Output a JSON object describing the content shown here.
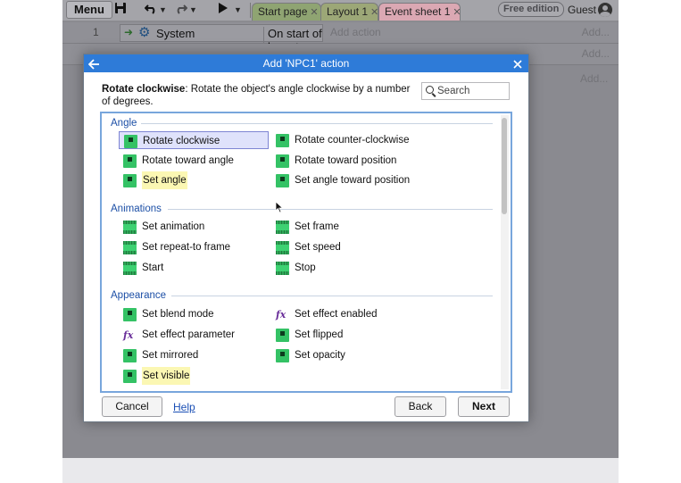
{
  "toolbar": {
    "menu_label": "Menu",
    "tabs": [
      {
        "label": "Start page",
        "close": "✕"
      },
      {
        "label": "Layout 1",
        "close": "✕"
      },
      {
        "label": "Event sheet 1",
        "close": "✕"
      }
    ],
    "edition_badge": "Free edition",
    "user_label": "Guest"
  },
  "event_sheet": {
    "row_number": "1",
    "object": "System",
    "trigger": "On start of layout",
    "add_action": "Add action",
    "add_label": "Add..."
  },
  "dialog": {
    "title": "Add 'NPC1' action",
    "description_bold": "Rotate clockwise",
    "description_rest": ": Rotate the object's angle clockwise by a number of degrees.",
    "search_placeholder": "Search",
    "categories": [
      {
        "name": "Angle",
        "items": [
          {
            "label": "Rotate clockwise",
            "icon": "sprite-icon",
            "selected": true
          },
          {
            "label": "Rotate counter-clockwise",
            "icon": "sprite-icon"
          },
          {
            "label": "Rotate toward angle",
            "icon": "sprite-icon"
          },
          {
            "label": "Rotate toward position",
            "icon": "sprite-icon"
          },
          {
            "label": "Set angle",
            "icon": "sprite-icon",
            "highlighted": true
          },
          {
            "label": "Set angle toward position",
            "icon": "sprite-icon"
          }
        ]
      },
      {
        "name": "Animations",
        "items": [
          {
            "label": "Set animation",
            "icon": "animation-icon"
          },
          {
            "label": "Set frame",
            "icon": "animation-icon"
          },
          {
            "label": "Set repeat-to frame",
            "icon": "animation-icon"
          },
          {
            "label": "Set speed",
            "icon": "animation-icon"
          },
          {
            "label": "Start",
            "icon": "animation-icon"
          },
          {
            "label": "Stop",
            "icon": "animation-icon"
          }
        ]
      },
      {
        "name": "Appearance",
        "items": [
          {
            "label": "Set blend mode",
            "icon": "sprite-icon"
          },
          {
            "label": "Set effect enabled",
            "icon": "effect-fx-icon"
          },
          {
            "label": "Set effect parameter",
            "icon": "effect-fx-icon"
          },
          {
            "label": "Set flipped",
            "icon": "sprite-icon"
          },
          {
            "label": "Set mirrored",
            "icon": "sprite-icon"
          },
          {
            "label": "Set opacity",
            "icon": "sprite-icon"
          },
          {
            "label": "Set visible",
            "icon": "sprite-icon",
            "highlighted": true
          }
        ]
      }
    ],
    "fx_glyph": "fx",
    "buttons": {
      "cancel": "Cancel",
      "help": "Help",
      "back": "Back",
      "next": "Next"
    }
  },
  "colors": {
    "title_bar": "#2e7bd8",
    "category_text": "#1c4fa6",
    "selection": "#dfe2fb",
    "highlight": "#fbf7b3",
    "sprite_icon": "#34c265"
  }
}
